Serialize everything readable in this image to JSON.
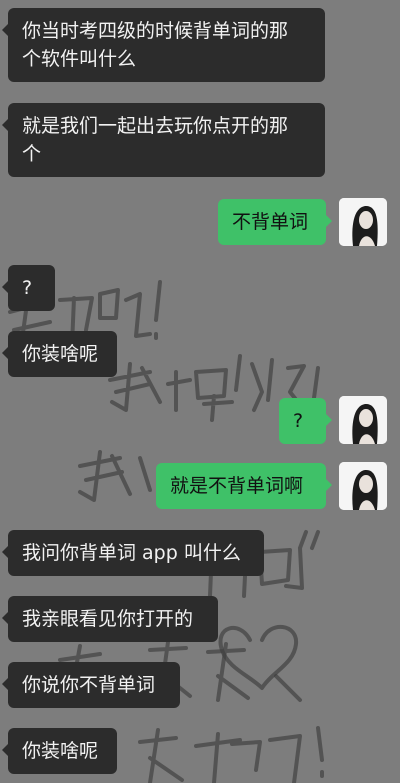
{
  "messages": [
    {
      "side": "in",
      "text": "你当时考四级的时候背单词的那\n个软件叫什么"
    },
    {
      "side": "in",
      "text": "就是我们一起出去玩你点开的那\n个"
    },
    {
      "side": "out",
      "text": "不背单词"
    },
    {
      "side": "in",
      "text": "?"
    },
    {
      "side": "in",
      "text": "你装啥呢"
    },
    {
      "side": "out",
      "text": "?"
    },
    {
      "side": "out",
      "text": "就是不背单词啊"
    },
    {
      "side": "in",
      "text": "我问你背单词 app 叫什么"
    },
    {
      "side": "in",
      "text": "我亲眼看见你打开的"
    },
    {
      "side": "in",
      "text": "你说你不背单词"
    },
    {
      "side": "in",
      "text": "你装啥呢"
    }
  ],
  "icons": {
    "avatar": "user-avatar-icon"
  },
  "colors": {
    "background": "#7d7d7d",
    "incoming_bubble": "#2c2c2c",
    "outgoing_bubble": "#3fc168"
  }
}
